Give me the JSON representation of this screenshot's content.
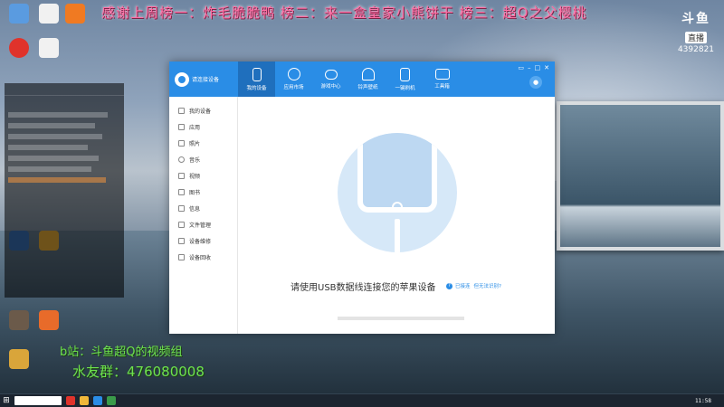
{
  "banner": {
    "text": "感谢上周榜一：炸毛脆脆鸭 榜二：来一盒皇家小熊饼干 榜三：超Q之父樱桃"
  },
  "logo": {
    "brand": "斗鱼",
    "sub": "直播",
    "room": "4392821"
  },
  "colors": {
    "accent": "#2a8de6",
    "banner": "#ff6fa5",
    "overlay_green": "#6ee24f"
  },
  "overlay": {
    "bili": "b站：斗鱼超Q的视频组",
    "qq": "水友群：476080008"
  },
  "app": {
    "connect_label": "请连接设备",
    "tabs": [
      {
        "label": "我的设备",
        "icon": "phone-icon"
      },
      {
        "label": "应用市场",
        "icon": "app-store-icon"
      },
      {
        "label": "游戏中心",
        "icon": "gamepad-icon"
      },
      {
        "label": "铃声壁纸",
        "icon": "bell-icon"
      },
      {
        "label": "一键刷机",
        "icon": "flash-icon"
      },
      {
        "label": "工具箱",
        "icon": "toolbox-icon"
      }
    ],
    "sidebar": [
      {
        "label": "我的设备"
      },
      {
        "label": "应用"
      },
      {
        "label": "照片"
      },
      {
        "label": "音乐"
      },
      {
        "label": "视频"
      },
      {
        "label": "图书"
      },
      {
        "label": "信息"
      },
      {
        "label": "文件管理"
      },
      {
        "label": "设备维修"
      },
      {
        "label": "设备回收"
      }
    ],
    "prompt": "请使用USB数据线连接您的苹果设备",
    "help": {
      "connected": "已接连",
      "cant_recognize": "但无法识别?"
    }
  },
  "taskbar": {
    "clock": "11:58"
  }
}
